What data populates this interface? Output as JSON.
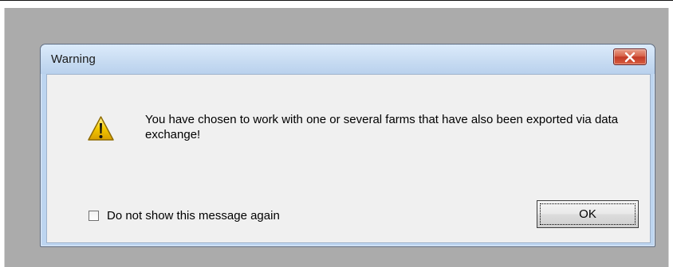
{
  "dialog": {
    "title": "Warning",
    "close_icon": "close-icon",
    "warning_icon": "warning-icon",
    "message": "You have chosen to work with one or several farms that have also been exported via data exchange!",
    "checkbox_label": "Do not show this message again",
    "checkbox_checked": false,
    "ok_label": "OK"
  },
  "colors": {
    "backdrop": "#ababab",
    "titlebar_gradient_top": "#dcebfb",
    "titlebar_gradient_bottom": "#b9d1ed",
    "client_background": "#f0f0f0",
    "close_button": "#c23b27",
    "warning_yellow": "#f3c900"
  }
}
